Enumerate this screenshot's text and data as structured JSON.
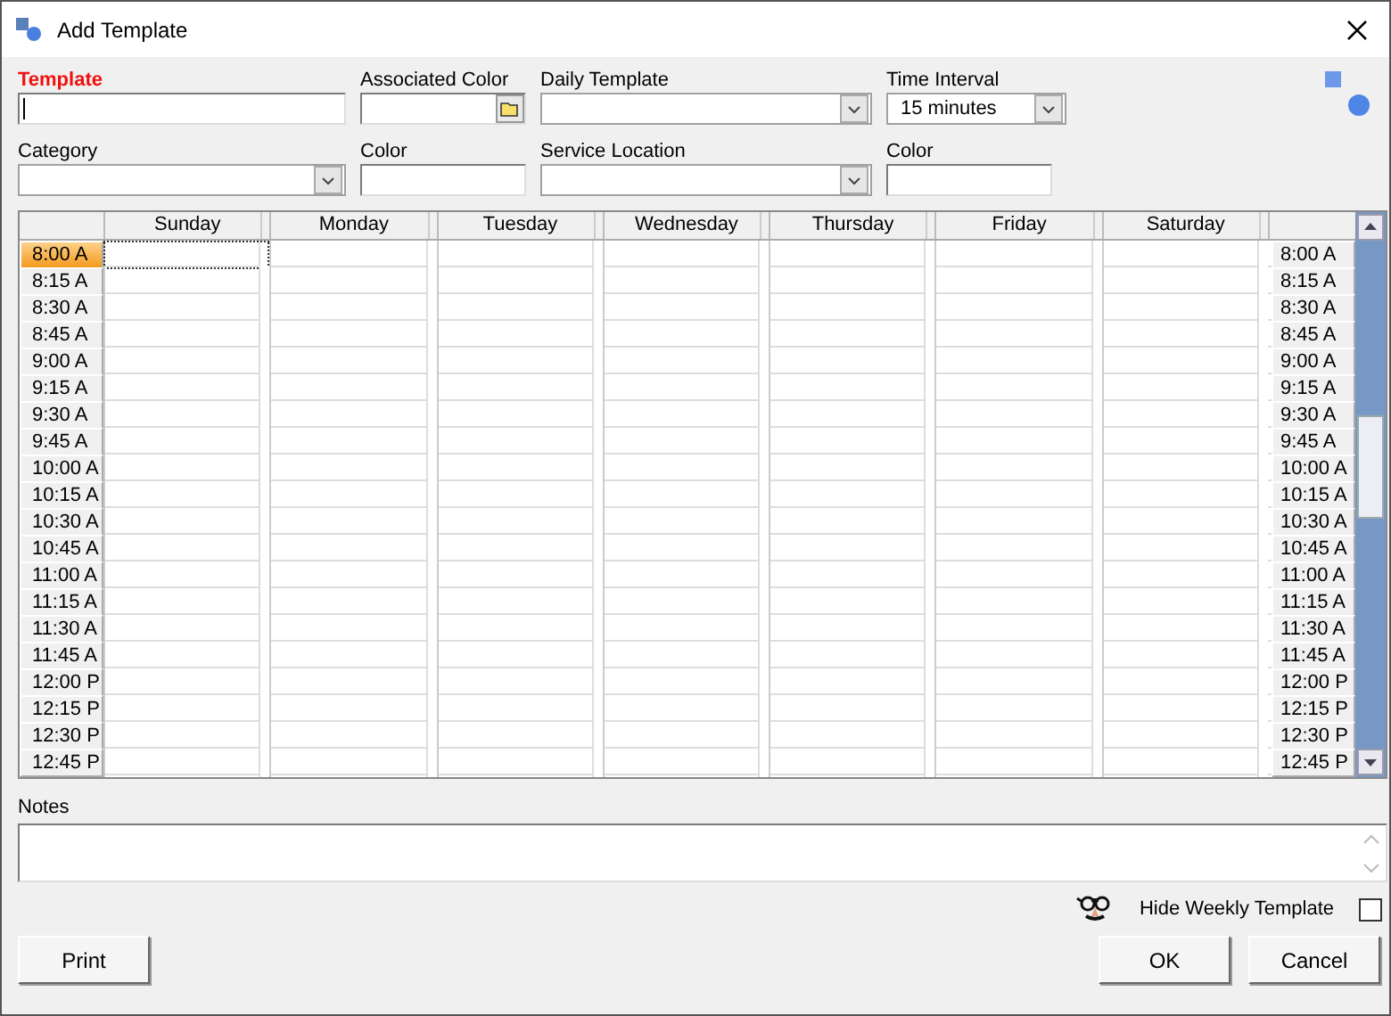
{
  "window": {
    "title": "Add Template"
  },
  "form": {
    "template": {
      "label": "Template",
      "focused": true
    },
    "associated_color": {
      "label": "Associated Color"
    },
    "daily_template": {
      "label": "Daily Template"
    },
    "time_interval": {
      "label": "Time Interval",
      "value": "15 minutes"
    },
    "category": {
      "label": "Category"
    },
    "color": {
      "label": "Color"
    },
    "service_location": {
      "label": "Service Location"
    },
    "color_2": {
      "label": "Color"
    }
  },
  "grid": {
    "days": [
      "Sunday",
      "Monday",
      "Tuesday",
      "Wednesday",
      "Thursday",
      "Friday",
      "Saturday"
    ],
    "rows": [
      {
        "time": "8:00 A",
        "right_time": "8:00 A",
        "selected": true
      },
      {
        "time": "8:15 A",
        "right_time": "8:15 A",
        "selected": false
      },
      {
        "time": "8:30 A",
        "right_time": "8:30 A",
        "selected": false
      },
      {
        "time": "8:45 A",
        "right_time": "8:45 A",
        "selected": false
      },
      {
        "time": "9:00 A",
        "right_time": "9:00 A",
        "selected": false
      },
      {
        "time": "9:15 A",
        "right_time": "9:15 A",
        "selected": false
      },
      {
        "time": "9:30 A",
        "right_time": "9:30 A",
        "selected": false
      },
      {
        "time": "9:45 A",
        "right_time": "9:45 A",
        "selected": false
      },
      {
        "time": "10:00 A",
        "right_time": "10:00 A",
        "selected": false
      },
      {
        "time": "10:15 A",
        "right_time": "10:15 A",
        "selected": false
      },
      {
        "time": "10:30 A",
        "right_time": "10:30 A",
        "selected": false
      },
      {
        "time": "10:45 A",
        "right_time": "10:45 A",
        "selected": false
      },
      {
        "time": "11:00 A",
        "right_time": "11:00 A",
        "selected": false
      },
      {
        "time": "11:15 A",
        "right_time": "11:15 A",
        "selected": false
      },
      {
        "time": "11:30 A",
        "right_time": "11:30 A",
        "selected": false
      },
      {
        "time": "11:45 A",
        "right_time": "11:45 A",
        "selected": false
      },
      {
        "time": "12:00 P",
        "right_time": "12:00 P",
        "selected": false
      },
      {
        "time": "12:15 P",
        "right_time": "12:15 P",
        "selected": false
      },
      {
        "time": "12:30 P",
        "right_time": "12:30 P",
        "selected": false
      },
      {
        "time": "12:45 P",
        "right_time": "12:45 P",
        "selected": false
      }
    ]
  },
  "notes": {
    "label": "Notes"
  },
  "hide_weekly_template": {
    "label": "Hide Weekly Template",
    "checked": false
  },
  "buttons": {
    "print": "Print",
    "ok": "OK",
    "cancel": "Cancel"
  }
}
